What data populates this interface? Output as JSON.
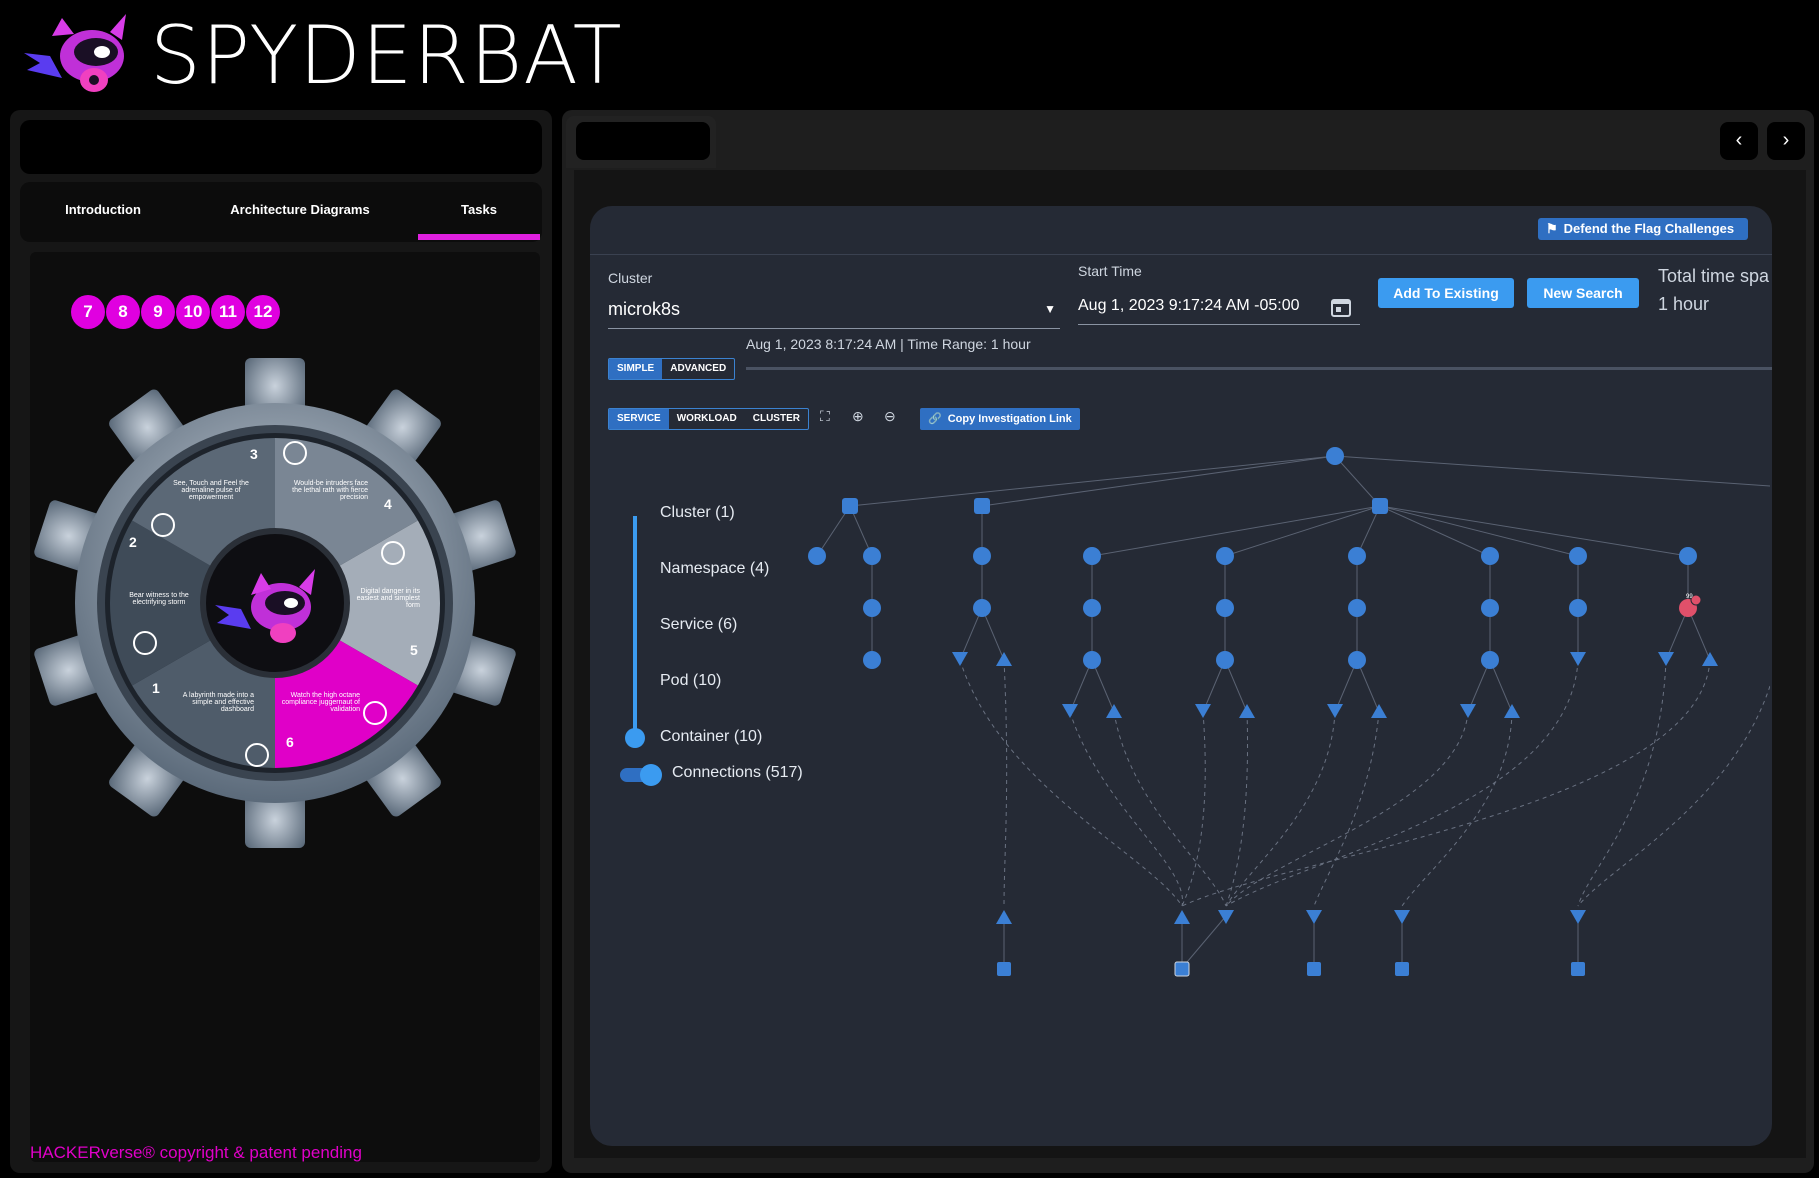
{
  "brand": {
    "name": "SPYDERBAT"
  },
  "left": {
    "tabs": [
      {
        "label": "Introduction"
      },
      {
        "label": "Architecture Diagrams"
      },
      {
        "label": "Tasks"
      }
    ],
    "active_tab": "Tasks",
    "task_numbers": [
      "7",
      "8",
      "9",
      "10",
      "11",
      "12"
    ],
    "gear": {
      "segments": [
        {
          "num": "1",
          "text": "A labyrinth made into a simple and effective dashboard"
        },
        {
          "num": "2",
          "text": "Bear witness to the electrifying storm"
        },
        {
          "num": "3",
          "text": "See, Touch and Feel the adrenaline pulse of empowerment"
        },
        {
          "num": "4",
          "text": "Would-be intruders face the lethal rath with fierce precision"
        },
        {
          "num": "5",
          "text": "Digital danger in its easiest and simplest form"
        },
        {
          "num": "6",
          "text": "Watch the high octane compliance juggernaut of validation"
        }
      ]
    },
    "copyright": "HACKERverse® copyright & patent pending"
  },
  "right": {
    "nav": {
      "prev": "‹",
      "next": "›"
    },
    "app": {
      "flag_button": "Defend the Flag Challenges",
      "cluster_label": "Cluster",
      "cluster_value": "microk8s",
      "start_time_label": "Start Time",
      "start_time_value": "Aug 1, 2023 9:17:24 AM -05:00",
      "add_button": "Add To Existing",
      "new_search_button": "New Search",
      "total_time_label": "Total time spa",
      "total_time_value": "1 hour",
      "range_text": "Aug 1, 2023 8:17:24 AM | Time Range: 1 hour",
      "mode_tabs": [
        "SIMPLE",
        "ADVANCED"
      ],
      "view_tabs": [
        "SERVICE",
        "WORKLOAD",
        "CLUSTER"
      ],
      "copy_link": "Copy Investigation Link",
      "legend": [
        {
          "label": "Cluster (1)"
        },
        {
          "label": "Namespace (4)"
        },
        {
          "label": "Service (6)"
        },
        {
          "label": "Pod (10)"
        },
        {
          "label": "Container (10)"
        },
        {
          "label": "Connections (517)"
        }
      ],
      "alert_badge": "99"
    }
  },
  "colors": {
    "accent": "#e000e0",
    "node_blue": "#3b7fd4",
    "alert_red": "#e0506a",
    "app_bg": "#252a35"
  }
}
